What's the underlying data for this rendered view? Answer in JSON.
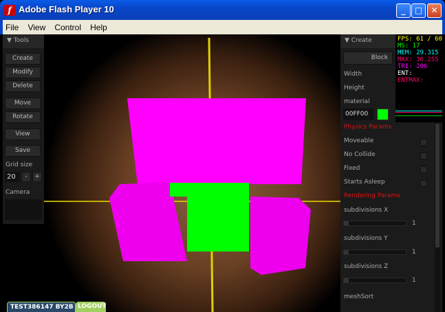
{
  "window": {
    "title": "Adobe Flash Player 10",
    "minimize": "_",
    "maximize": "□",
    "close": "✕"
  },
  "menu": [
    "File",
    "View",
    "Control",
    "Help"
  ],
  "tools": {
    "header": "Tools",
    "buttons": [
      "Create",
      "Modify",
      "Delete",
      "Move",
      "Rotate",
      "View",
      "Save"
    ],
    "grid_label": "Grid size",
    "grid_value": "20",
    "minus": "-",
    "plus": "+",
    "camera_label": "Camera"
  },
  "create": {
    "header": "Create",
    "block_button": "Block",
    "width_label": "Width",
    "height_label": "Height",
    "material_label": "material",
    "material_value": "00FF00",
    "material_color": "#00ff00",
    "physics_header": "Physics Params",
    "physics": [
      "Moveable",
      "No Collide",
      "Fixed",
      "Starts Asleep"
    ],
    "render_header": "Rendering Params",
    "sliders": [
      {
        "label": "subdivisions X",
        "value": "1"
      },
      {
        "label": "subdivisions Y",
        "value": "1"
      },
      {
        "label": "subdivisions Z",
        "value": "1"
      }
    ],
    "mesh_label": "meshSort"
  },
  "stats": {
    "fps": "FPS: 61 / 60",
    "ms": "MS: 17",
    "mem": "MEM: 29.315",
    "max": "MAX: 36.255",
    "tri": "TRI: 206",
    "ent": "ENT:",
    "entmax": "ENTMAX:"
  },
  "footer": {
    "user": "TEST386147  BY2B",
    "logout": "LOGOUT"
  }
}
